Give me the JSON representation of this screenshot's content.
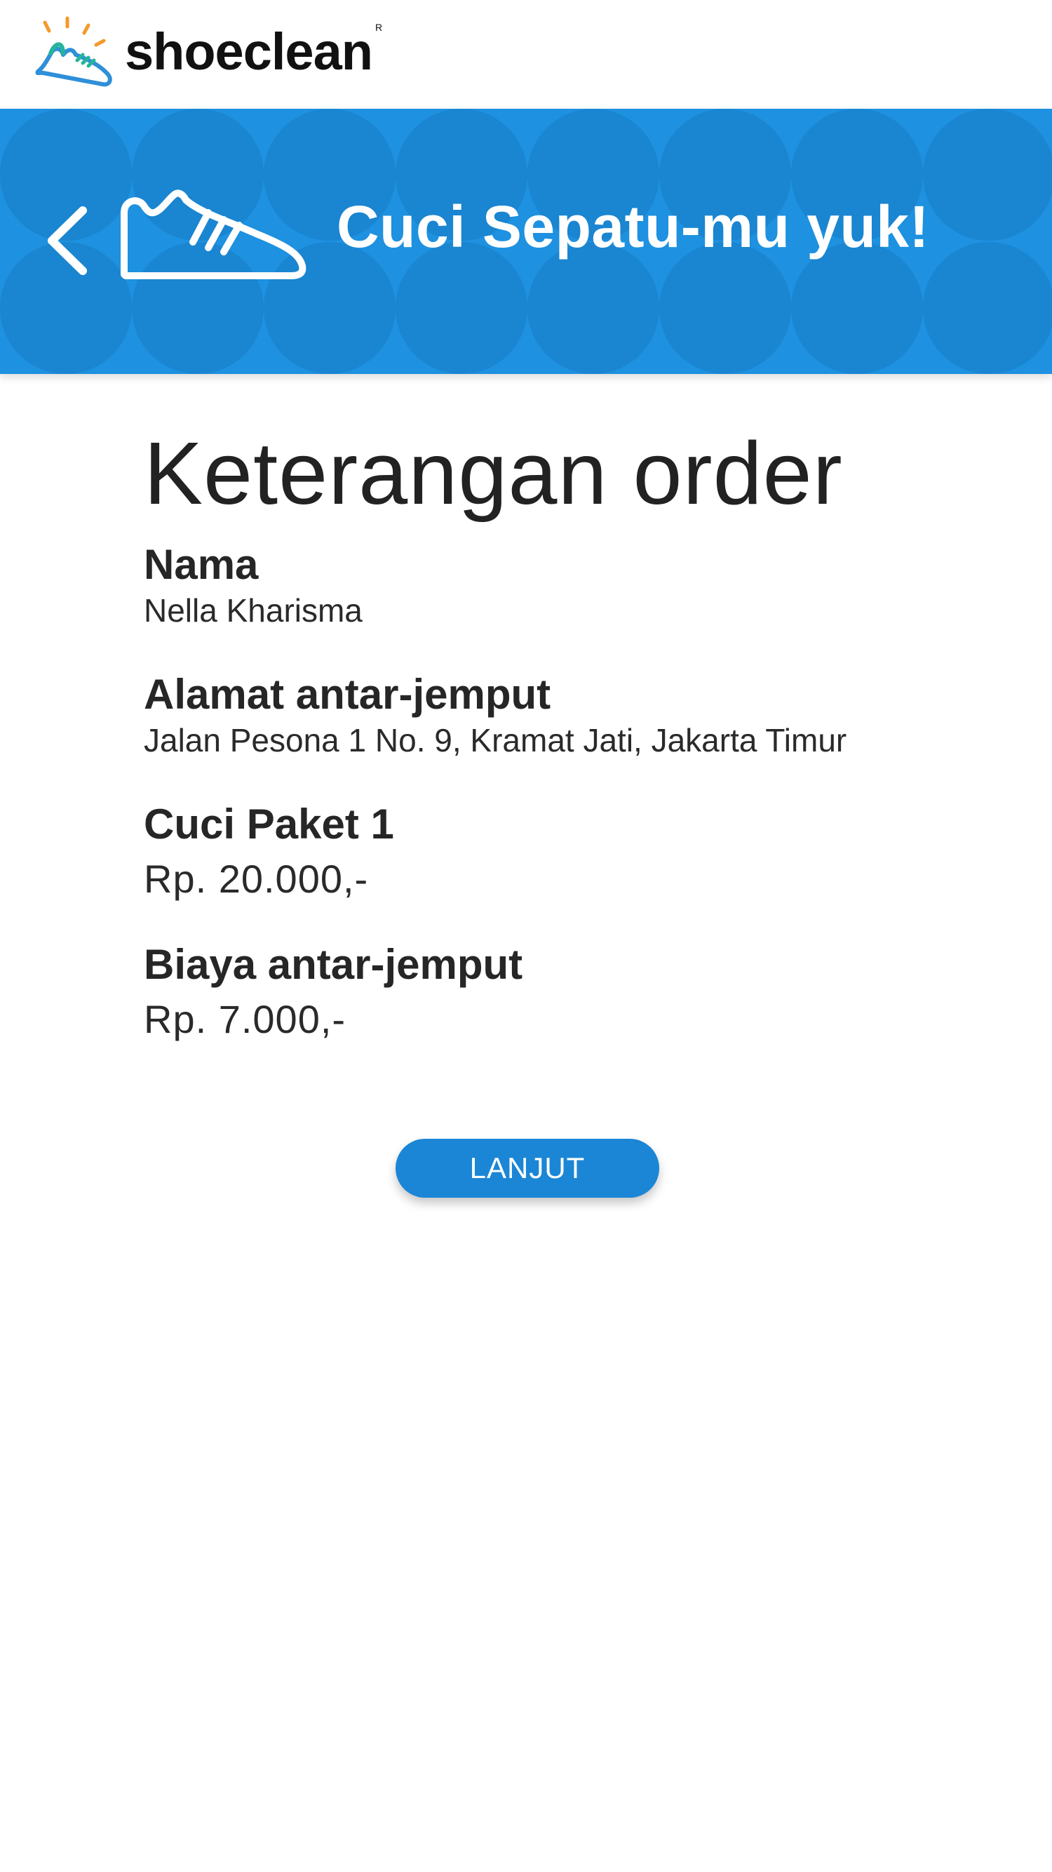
{
  "app": {
    "brand_name": "shoeclean",
    "brand_reg": "R"
  },
  "banner": {
    "title": "Cuci Sepatu-mu yuk!",
    "color": "#1e91e0",
    "pattern_color": "#1a85d0"
  },
  "order": {
    "heading": "Keterangan order",
    "fields": [
      {
        "label": "Nama",
        "value": "Nella Kharisma"
      },
      {
        "label": "Alamat antar-jemput",
        "value": "Jalan Pesona 1 No. 9, Kramat Jati, Jakarta Timur"
      },
      {
        "label": "Cuci Paket 1",
        "value": "Rp. 20.000,-"
      },
      {
        "label": "Biaya antar-jemput",
        "value": "Rp. 7.000,-"
      }
    ]
  },
  "actions": {
    "continue_label": "LANJUT",
    "button_color": "#1b86d6"
  },
  "icons": {
    "logo": "sparkling-shoe-logo-icon",
    "back": "chevron-left-icon",
    "shoe": "sneaker-icon"
  }
}
